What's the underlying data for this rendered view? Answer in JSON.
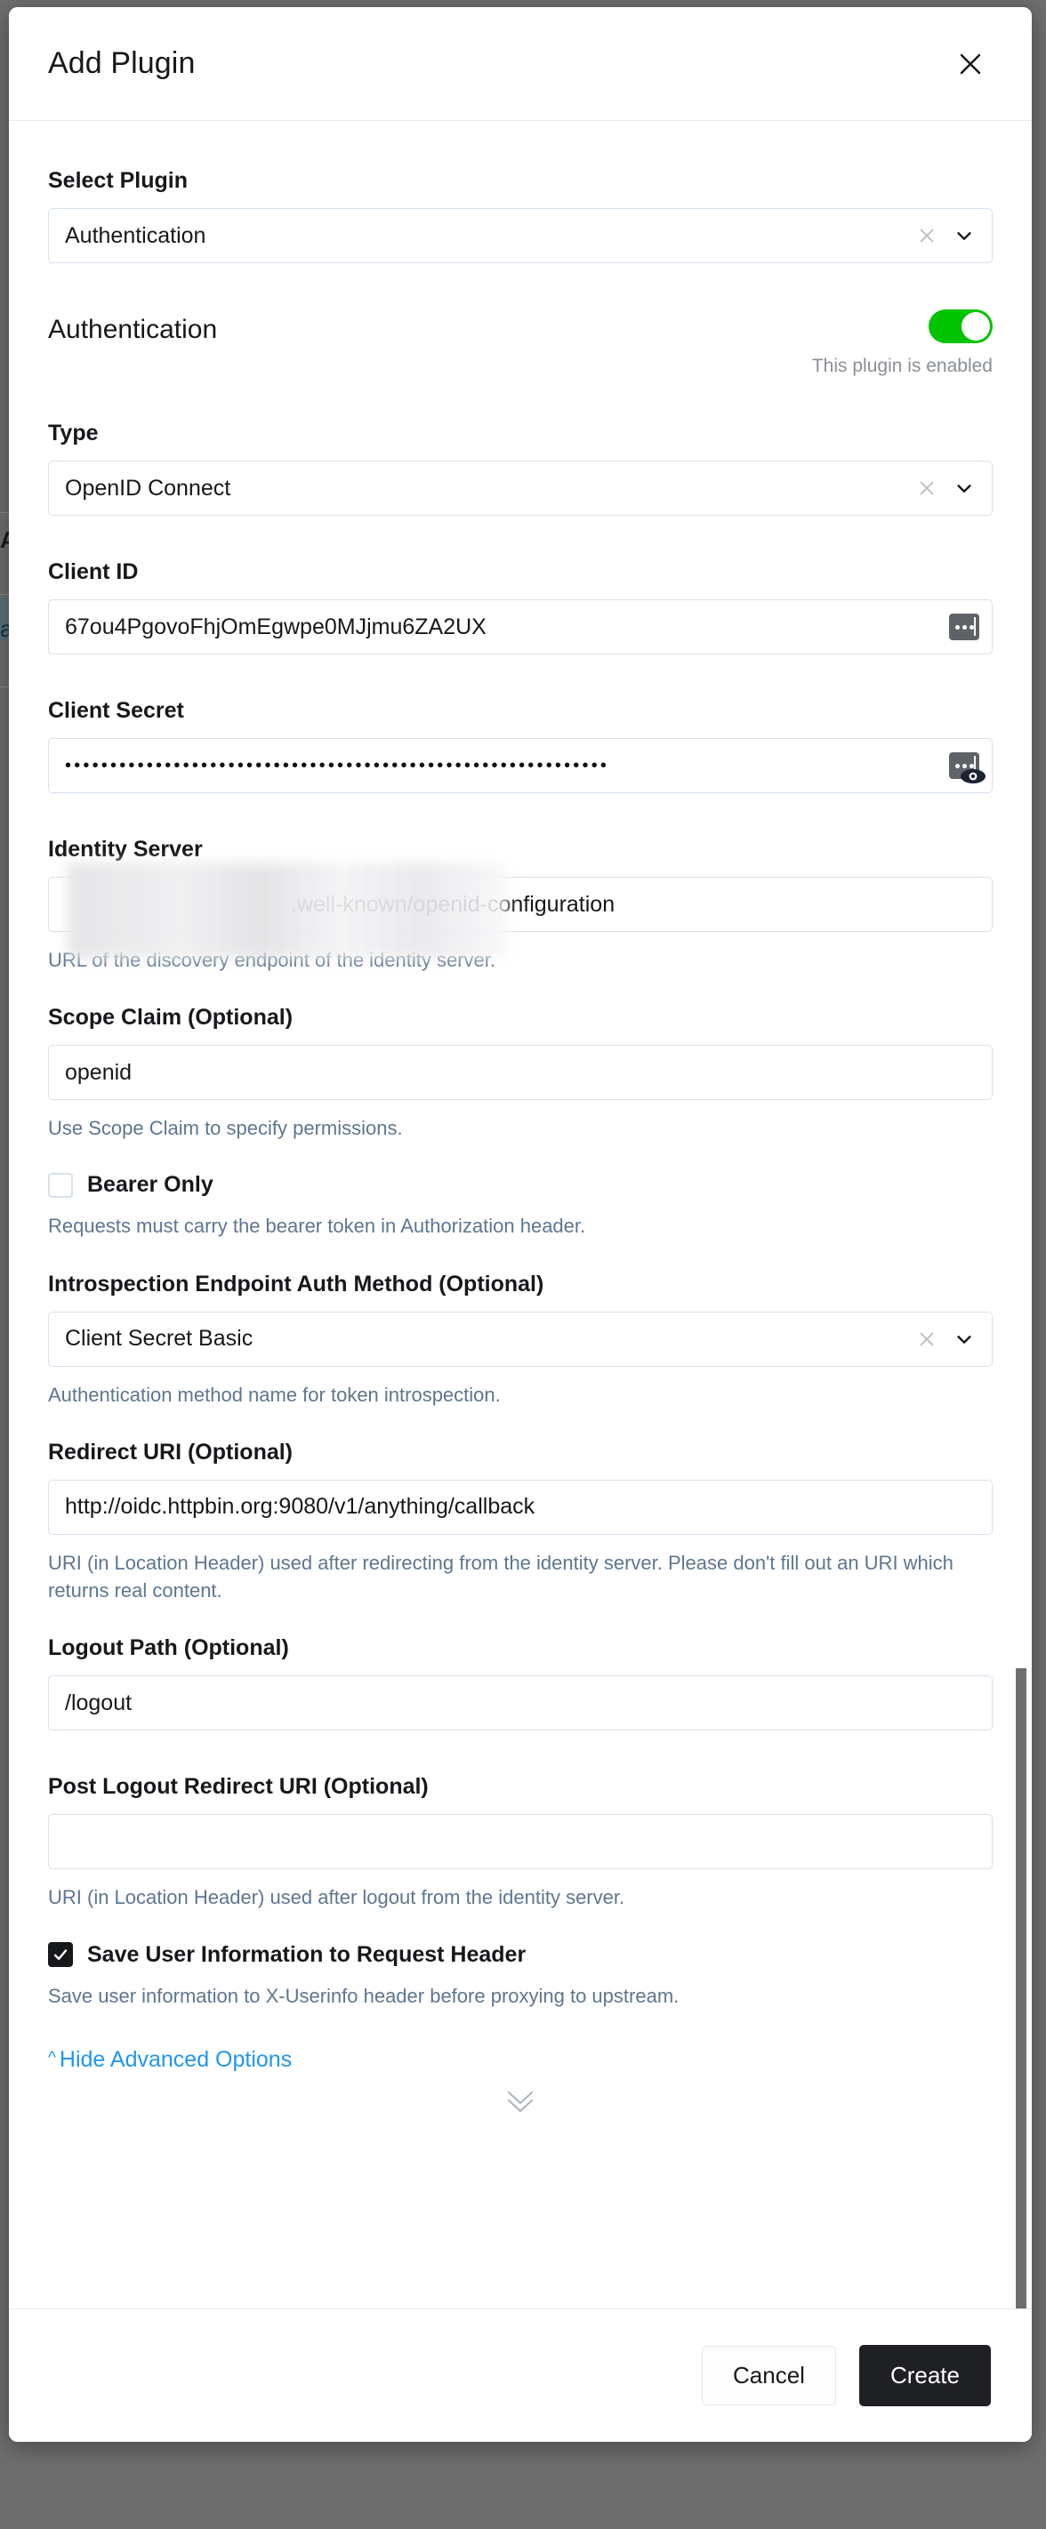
{
  "modal": {
    "title": "Add Plugin",
    "close_icon": "close-icon"
  },
  "form": {
    "select_plugin": {
      "label": "Select Plugin",
      "value": "Authentication",
      "clear_icon": "clear-x-icon",
      "chevron_icon": "chevron-down-icon"
    },
    "plugin_header": {
      "name": "Authentication",
      "toggle_state": "on",
      "toggle_note": "This plugin is enabled"
    },
    "type": {
      "label": "Type",
      "value": "OpenID Connect",
      "clear_icon": "clear-x-icon",
      "chevron_icon": "chevron-down-icon"
    },
    "client_id": {
      "label": "Client ID",
      "value": "67ou4PgovoFhjOmEgwpe0MJjmu6ZA2UX",
      "action_icon": "password-dots-icon"
    },
    "client_secret": {
      "label": "Client Secret",
      "value": "••••••••••••••••••••••••••••••••••••••••••••••••••••••••••••",
      "action_icon": "reveal-password-eye-icon"
    },
    "identity_server": {
      "label": "Identity Server",
      "value": ".well-known/openid-configuration",
      "redacted": true,
      "hint": "URL of the discovery endpoint of the identity server."
    },
    "scope_claim": {
      "label": "Scope Claim (Optional)",
      "value": "openid",
      "hint": "Use Scope Claim to specify permissions."
    },
    "bearer_only": {
      "label": "Bearer Only",
      "checked": false,
      "hint": "Requests must carry the bearer token in Authorization header."
    },
    "introspection_auth_method": {
      "label": "Introspection Endpoint Auth Method (Optional)",
      "value": "Client Secret Basic",
      "clear_icon": "clear-x-icon",
      "chevron_icon": "chevron-down-icon",
      "hint": "Authentication method name for token introspection."
    },
    "redirect_uri": {
      "label": "Redirect URI (Optional)",
      "value": "http://oidc.httpbin.org:9080/v1/anything/callback",
      "hint": "URI (in Location Header) used after redirecting from the identity server. Please don't fill out an URI which returns real content."
    },
    "logout_path": {
      "label": "Logout Path (Optional)",
      "value": "/logout",
      "placeholder": ""
    },
    "post_logout_redirect_uri": {
      "label": "Post Logout Redirect URI (Optional)",
      "value": "",
      "placeholder": "",
      "hint": "URI (in Location Header) used after logout from the identity server."
    },
    "save_user_info": {
      "label": "Save User Information to Request Header",
      "checked": true,
      "hint": "Save user information to X-Userinfo header before proxying to upstream."
    },
    "advanced_toggle": {
      "label": "Hide Advanced Options",
      "caret": "^",
      "scroll_down_icon": "double-chevron-down-icon"
    }
  },
  "footer": {
    "cancel_label": "Cancel",
    "create_label": "Create"
  },
  "background": {
    "fragment_one": "A",
    "fragment_two": "a"
  },
  "colors": {
    "toggle_on": "#00c400",
    "accent_link": "#2196f3",
    "primary_button": "#1f2023",
    "hint_text": "#5d7691",
    "field_border": "#d6e1ec",
    "backdrop": "#6e6e6e"
  }
}
